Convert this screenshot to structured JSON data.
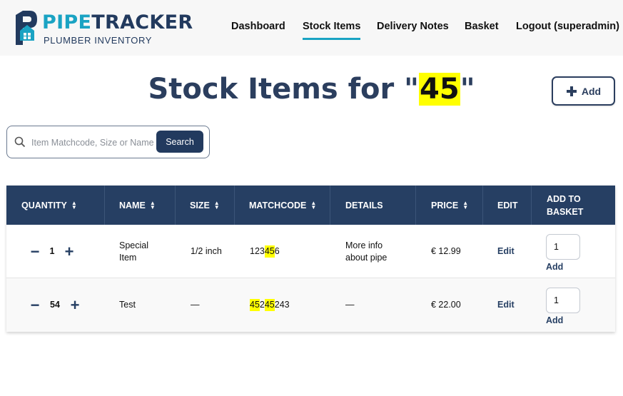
{
  "brand": {
    "name_part1": "PIPE",
    "name_part2": "TRACKER",
    "tagline": "PLUMBER INVENTORY",
    "primary_color": "#223a5e",
    "accent_color": "#1aa3c3"
  },
  "nav": {
    "dashboard": "Dashboard",
    "stock_items": "Stock Items",
    "delivery_notes": "Delivery Notes",
    "basket": "Basket",
    "logout": "Logout (superadmin)",
    "active": "stock_items"
  },
  "page": {
    "title_prefix": "Stock Items for \"",
    "query": "45",
    "title_suffix": "\"",
    "add_label": "Add"
  },
  "search": {
    "placeholder": "Item Matchcode, Size or Name",
    "value": "",
    "button": "Search"
  },
  "table": {
    "headers": {
      "quantity": "QUANTITY",
      "name": "NAME",
      "size": "SIZE",
      "matchcode": "MATCHCODE",
      "details": "DETAILS",
      "price": "PRICE",
      "edit": "EDIT",
      "add_to_basket_1": "ADD TO",
      "add_to_basket_2": "BASKET"
    },
    "rows": [
      {
        "quantity": "1",
        "name_1": "Special",
        "name_2": "Item",
        "size": "1/2 inch",
        "matchcode": {
          "a": "123",
          "b": "45",
          "c": "6"
        },
        "details_1": "More info",
        "details_2": "about pipe",
        "price": "€ 12.99",
        "edit": "Edit",
        "basket_value": "1",
        "basket_add": "Add"
      },
      {
        "quantity": "54",
        "name_1": "Test",
        "size": "—",
        "matchcode": {
          "a": "45",
          "b": "2",
          "c": "45",
          "d": "243"
        },
        "details_1": "—",
        "price": "€ 22.00",
        "edit": "Edit",
        "basket_value": "1",
        "basket_add": "Add"
      }
    ]
  }
}
